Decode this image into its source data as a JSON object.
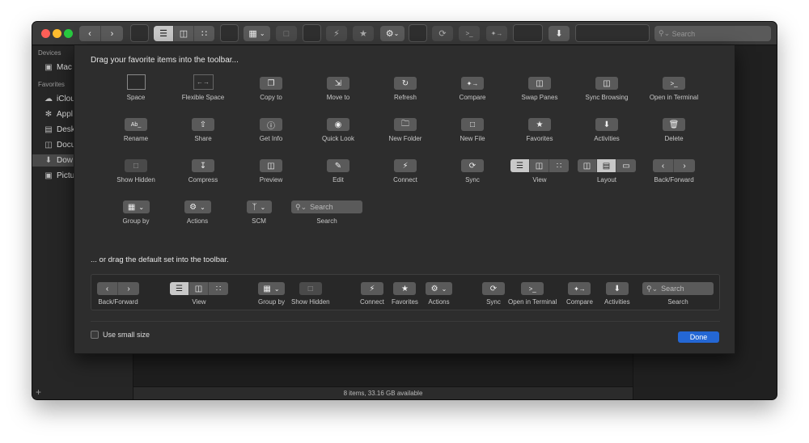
{
  "window": {
    "traffic_lights": {
      "close": "#ff5f57",
      "minimize": "#febc2e",
      "zoom": "#28c840"
    },
    "toolbar": {
      "search_placeholder": "Search"
    },
    "status_text": "8 items, 33.16 GB available"
  },
  "sidebar": {
    "devices_header": "Devices",
    "favorites_header": "Favorites",
    "devices": [
      {
        "label": "Mac",
        "icon": "computer-icon"
      }
    ],
    "favorites": [
      {
        "label": "iClou",
        "icon": "cloud-icon"
      },
      {
        "label": "Appl",
        "icon": "applications-icon"
      },
      {
        "label": "Desk",
        "icon": "desktop-icon"
      },
      {
        "label": "Docu",
        "icon": "document-icon"
      },
      {
        "label": "Dow",
        "icon": "download-icon"
      },
      {
        "label": "Pictu",
        "icon": "pictures-icon"
      }
    ]
  },
  "sheet": {
    "title": "Drag your favorite items into the toolbar...",
    "items": [
      {
        "label": "Space",
        "icon": "space"
      },
      {
        "label": "Flexible Space",
        "icon": "flexible-space"
      },
      {
        "label": "Copy to",
        "icon": "copy-icon"
      },
      {
        "label": "Move to",
        "icon": "move-icon"
      },
      {
        "label": "Refresh",
        "icon": "refresh-icon"
      },
      {
        "label": "Compare",
        "icon": "compare-icon"
      },
      {
        "label": "Swap Panes",
        "icon": "swap-panes-icon"
      },
      {
        "label": "Sync Browsing",
        "icon": "sync-browsing-icon"
      },
      {
        "label": "Open in Terminal",
        "icon": "terminal-icon"
      },
      {
        "label": "Rename",
        "icon": "rename-icon"
      },
      {
        "label": "Share",
        "icon": "share-icon"
      },
      {
        "label": "Get Info",
        "icon": "info-icon"
      },
      {
        "label": "Quick Look",
        "icon": "eye-icon"
      },
      {
        "label": "New Folder",
        "icon": "new-folder-icon"
      },
      {
        "label": "New File",
        "icon": "new-file-icon"
      },
      {
        "label": "Favorites",
        "icon": "star-icon"
      },
      {
        "label": "Activities",
        "icon": "download-circle-icon"
      },
      {
        "label": "Delete",
        "icon": "trash-icon"
      },
      {
        "label": "Show Hidden",
        "icon": "hidden-file-icon"
      },
      {
        "label": "Compress",
        "icon": "compress-icon"
      },
      {
        "label": "Preview",
        "icon": "preview-icon"
      },
      {
        "label": "Edit",
        "icon": "pencil-icon"
      },
      {
        "label": "Connect",
        "icon": "bolt-icon"
      },
      {
        "label": "Sync",
        "icon": "sync-icon"
      },
      {
        "label": "View",
        "icon": "view-segment"
      },
      {
        "label": "Layout",
        "icon": "layout-segment"
      },
      {
        "label": "Back/Forward",
        "icon": "back-forward-segment"
      },
      {
        "label": "Group by",
        "icon": "group-by-icon"
      },
      {
        "label": "Actions",
        "icon": "gear-icon"
      },
      {
        "label": "SCM",
        "icon": "branch-icon"
      },
      {
        "label": "Search",
        "icon": "search-field"
      }
    ],
    "search_placeholder": "Search",
    "default_title": "... or drag the default set into the toolbar.",
    "default_items": [
      {
        "label": "Back/Forward"
      },
      {
        "label": "View"
      },
      {
        "label": "Group by"
      },
      {
        "label": "Show Hidden"
      },
      {
        "label": "Connect"
      },
      {
        "label": "Favorites"
      },
      {
        "label": "Actions"
      },
      {
        "label": "Sync"
      },
      {
        "label": "Open in Terminal"
      },
      {
        "label": "Compare"
      },
      {
        "label": "Activities"
      },
      {
        "label": "Search"
      }
    ],
    "small_size_label": "Use small size",
    "done_label": "Done",
    "done_color": "#2467d4"
  }
}
